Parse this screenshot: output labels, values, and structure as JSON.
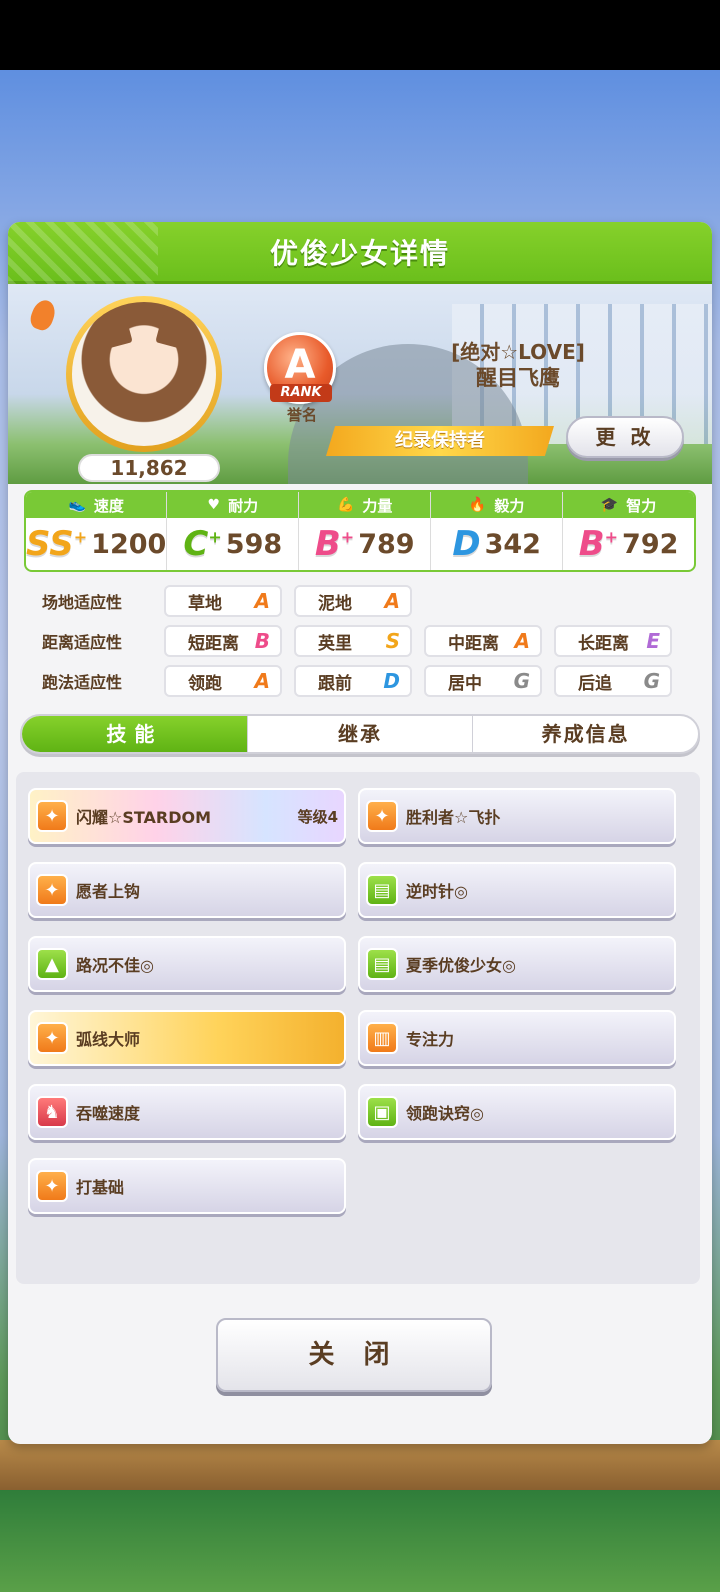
{
  "header": {
    "title": "优俊少女详情"
  },
  "profile": {
    "fans": "11,862",
    "rank_letter": "A",
    "rank_tag": "RANK",
    "rank_label": "誉名",
    "title_epithet": "[绝对☆LOVE]",
    "name": "醒目飞鹰",
    "record_badge": "纪录保持者",
    "change_label": "更 改"
  },
  "stats": [
    {
      "label": "速度",
      "icon": "shoe-icon",
      "grade": "SS",
      "plus": "+",
      "value": "1200",
      "color": "#f2a51a"
    },
    {
      "label": "耐力",
      "icon": "heart-icon",
      "grade": "C",
      "plus": "+",
      "value": "598",
      "color": "#5fb314"
    },
    {
      "label": "力量",
      "icon": "muscle-icon",
      "grade": "B",
      "plus": "+",
      "value": "789",
      "color": "#ee4c8a"
    },
    {
      "label": "毅力",
      "icon": "flame-icon",
      "grade": "D",
      "plus": "",
      "value": "342",
      "color": "#2d96e0"
    },
    {
      "label": "智力",
      "icon": "cap-icon",
      "grade": "B",
      "plus": "+",
      "value": "792",
      "color": "#ee4c8a"
    }
  ],
  "aptitude": {
    "track": {
      "label": "场地适应性",
      "items": [
        {
          "name": "草地",
          "grade": "A"
        },
        {
          "name": "泥地",
          "grade": "A"
        }
      ]
    },
    "distance": {
      "label": "距离适应性",
      "items": [
        {
          "name": "短距离",
          "grade": "B"
        },
        {
          "name": "英里",
          "grade": "S"
        },
        {
          "name": "中距离",
          "grade": "A"
        },
        {
          "name": "长距离",
          "grade": "E"
        }
      ]
    },
    "style": {
      "label": "跑法适应性",
      "items": [
        {
          "name": "领跑",
          "grade": "A"
        },
        {
          "name": "跟前",
          "grade": "D"
        },
        {
          "name": "居中",
          "grade": "G"
        },
        {
          "name": "后追",
          "grade": "G"
        }
      ]
    }
  },
  "grade_colors": {
    "S": "#f2a51a",
    "A": "#f07a1a",
    "B": "#ee4c8a",
    "D": "#2d96e0",
    "E": "#b06ad6",
    "G": "#8a8a8a"
  },
  "tabs": [
    {
      "label": "技能"
    },
    {
      "label": "继承"
    },
    {
      "label": "养成信息"
    }
  ],
  "skills": [
    {
      "name": "闪耀☆STARDOM",
      "level": "等级4",
      "icon": "run-icon",
      "style": "rainbow"
    },
    {
      "name": "胜利者☆飞扑",
      "level": "",
      "icon": "run-icon",
      "style": "normal"
    },
    {
      "name": "愿者上钩",
      "level": "",
      "icon": "run-icon",
      "style": "normal"
    },
    {
      "name": "逆时针◎",
      "level": "",
      "icon": "card-icon",
      "style": "normal"
    },
    {
      "name": "路况不佳◎",
      "level": "",
      "icon": "muscle-icon",
      "style": "normal"
    },
    {
      "name": "夏季优俊少女◎",
      "level": "",
      "icon": "card-icon",
      "style": "normal"
    },
    {
      "name": "弧线大师",
      "level": "",
      "icon": "run-icon",
      "style": "gold"
    },
    {
      "name": "专注力",
      "level": "",
      "icon": "gate-icon",
      "style": "normal"
    },
    {
      "name": "吞噬速度",
      "level": "",
      "icon": "horse-icon",
      "style": "normal"
    },
    {
      "name": "领跑诀窍◎",
      "level": "",
      "icon": "book-icon",
      "style": "normal"
    },
    {
      "name": "打基础",
      "level": "",
      "icon": "run-icon",
      "style": "normal"
    }
  ],
  "close_label": "关 闭"
}
